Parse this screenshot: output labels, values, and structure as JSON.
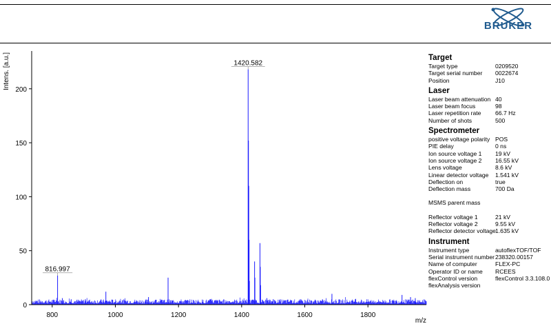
{
  "logo": {
    "text": "BRUKER",
    "color": "#1f5a8e"
  },
  "chart_data": {
    "type": "line",
    "xlabel": "m/z",
    "ylabel": "Intens. [a.u.]",
    "xlim": [
      735,
      1985
    ],
    "ylim": [
      0,
      235
    ],
    "xticks": [
      800,
      1000,
      1200,
      1400,
      1600,
      1800
    ],
    "yticks": [
      0,
      50,
      100,
      150,
      200
    ],
    "color": "#1a1aff",
    "noise_floor": 3,
    "peaks": [
      {
        "x": 816.997,
        "y": 27
      },
      {
        "x": 832,
        "y": 6
      },
      {
        "x": 860,
        "y": 5
      },
      {
        "x": 905,
        "y": 5
      },
      {
        "x": 970,
        "y": 12
      },
      {
        "x": 1105,
        "y": 7
      },
      {
        "x": 1167,
        "y": 25
      },
      {
        "x": 1300,
        "y": 5
      },
      {
        "x": 1420.582,
        "y": 218
      },
      {
        "x": 1421.58,
        "y": 152
      },
      {
        "x": 1422.58,
        "y": 110
      },
      {
        "x": 1423.58,
        "y": 60
      },
      {
        "x": 1424.58,
        "y": 22
      },
      {
        "x": 1441,
        "y": 40
      },
      {
        "x": 1442,
        "y": 25
      },
      {
        "x": 1458,
        "y": 57
      },
      {
        "x": 1459,
        "y": 35
      },
      {
        "x": 1460,
        "y": 18
      },
      {
        "x": 1480,
        "y": 6
      },
      {
        "x": 1500,
        "y": 5
      },
      {
        "x": 1686,
        "y": 10
      },
      {
        "x": 1760,
        "y": 5
      },
      {
        "x": 1908,
        "y": 9
      },
      {
        "x": 1935,
        "y": 7
      },
      {
        "x": 1950,
        "y": 6
      }
    ],
    "peak_labels": [
      {
        "x": 816.997,
        "y": 27,
        "text": "816.997"
      },
      {
        "x": 1420.582,
        "y": 218,
        "text": "1420.582"
      }
    ]
  },
  "info": [
    {
      "title": "Target",
      "rows": [
        {
          "key": "Target type",
          "value": "0209520"
        },
        {
          "key": "Target serial number",
          "value": "0022674"
        },
        {
          "key": "Position",
          "value": "J10"
        }
      ]
    },
    {
      "title": "Laser",
      "rows": [
        {
          "key": "Laser beam attenuation",
          "value": "40"
        },
        {
          "key": "Laser beam focus",
          "value": "98"
        },
        {
          "key": "Laser repetition rate",
          "value": "66.7 Hz"
        },
        {
          "key": "Number of shots",
          "value": "500"
        }
      ]
    },
    {
      "title": "Spectrometer",
      "rows": [
        {
          "key": "positive voltage polarity",
          "value": "POS"
        },
        {
          "key": "PIE delay",
          "value": "0 ns"
        },
        {
          "key": "Ion source voltage 1",
          "value": "19 kV"
        },
        {
          "key": "Ion source voltage 2",
          "value": "16.55 kV"
        },
        {
          "key": "Lens voltage",
          "value": "8.6 kV"
        },
        {
          "key": "Linear detector voltage",
          "value": "1.541 kV"
        },
        {
          "key": "Deflection on",
          "value": "true"
        },
        {
          "key": "Deflection mass",
          "value": "700 Da"
        },
        {
          "gap": true
        },
        {
          "key": "MSMS parent mass",
          "value": ""
        },
        {
          "gap": true
        },
        {
          "key": "Reflector voltage 1",
          "value": "21 kV"
        },
        {
          "key": "Reflector voltage 2",
          "value": "9.55 kV"
        },
        {
          "key": "Reflector detector voltage",
          "value": "1.635 kV"
        }
      ]
    },
    {
      "title": "Instrument",
      "rows": [
        {
          "key": "Instrument type",
          "value": "autoflexTOF/TOF"
        },
        {
          "key": "Serial instrument number",
          "value": "238320.00157"
        },
        {
          "key": "Name of computer",
          "value": "FLEX-PC"
        },
        {
          "key": "Operator ID or name",
          "value": "RCEES"
        },
        {
          "key": "flexControl version",
          "value": "flexControl 3.3.108.0"
        },
        {
          "key": "flexAnalysis version",
          "value": ""
        }
      ]
    }
  ]
}
